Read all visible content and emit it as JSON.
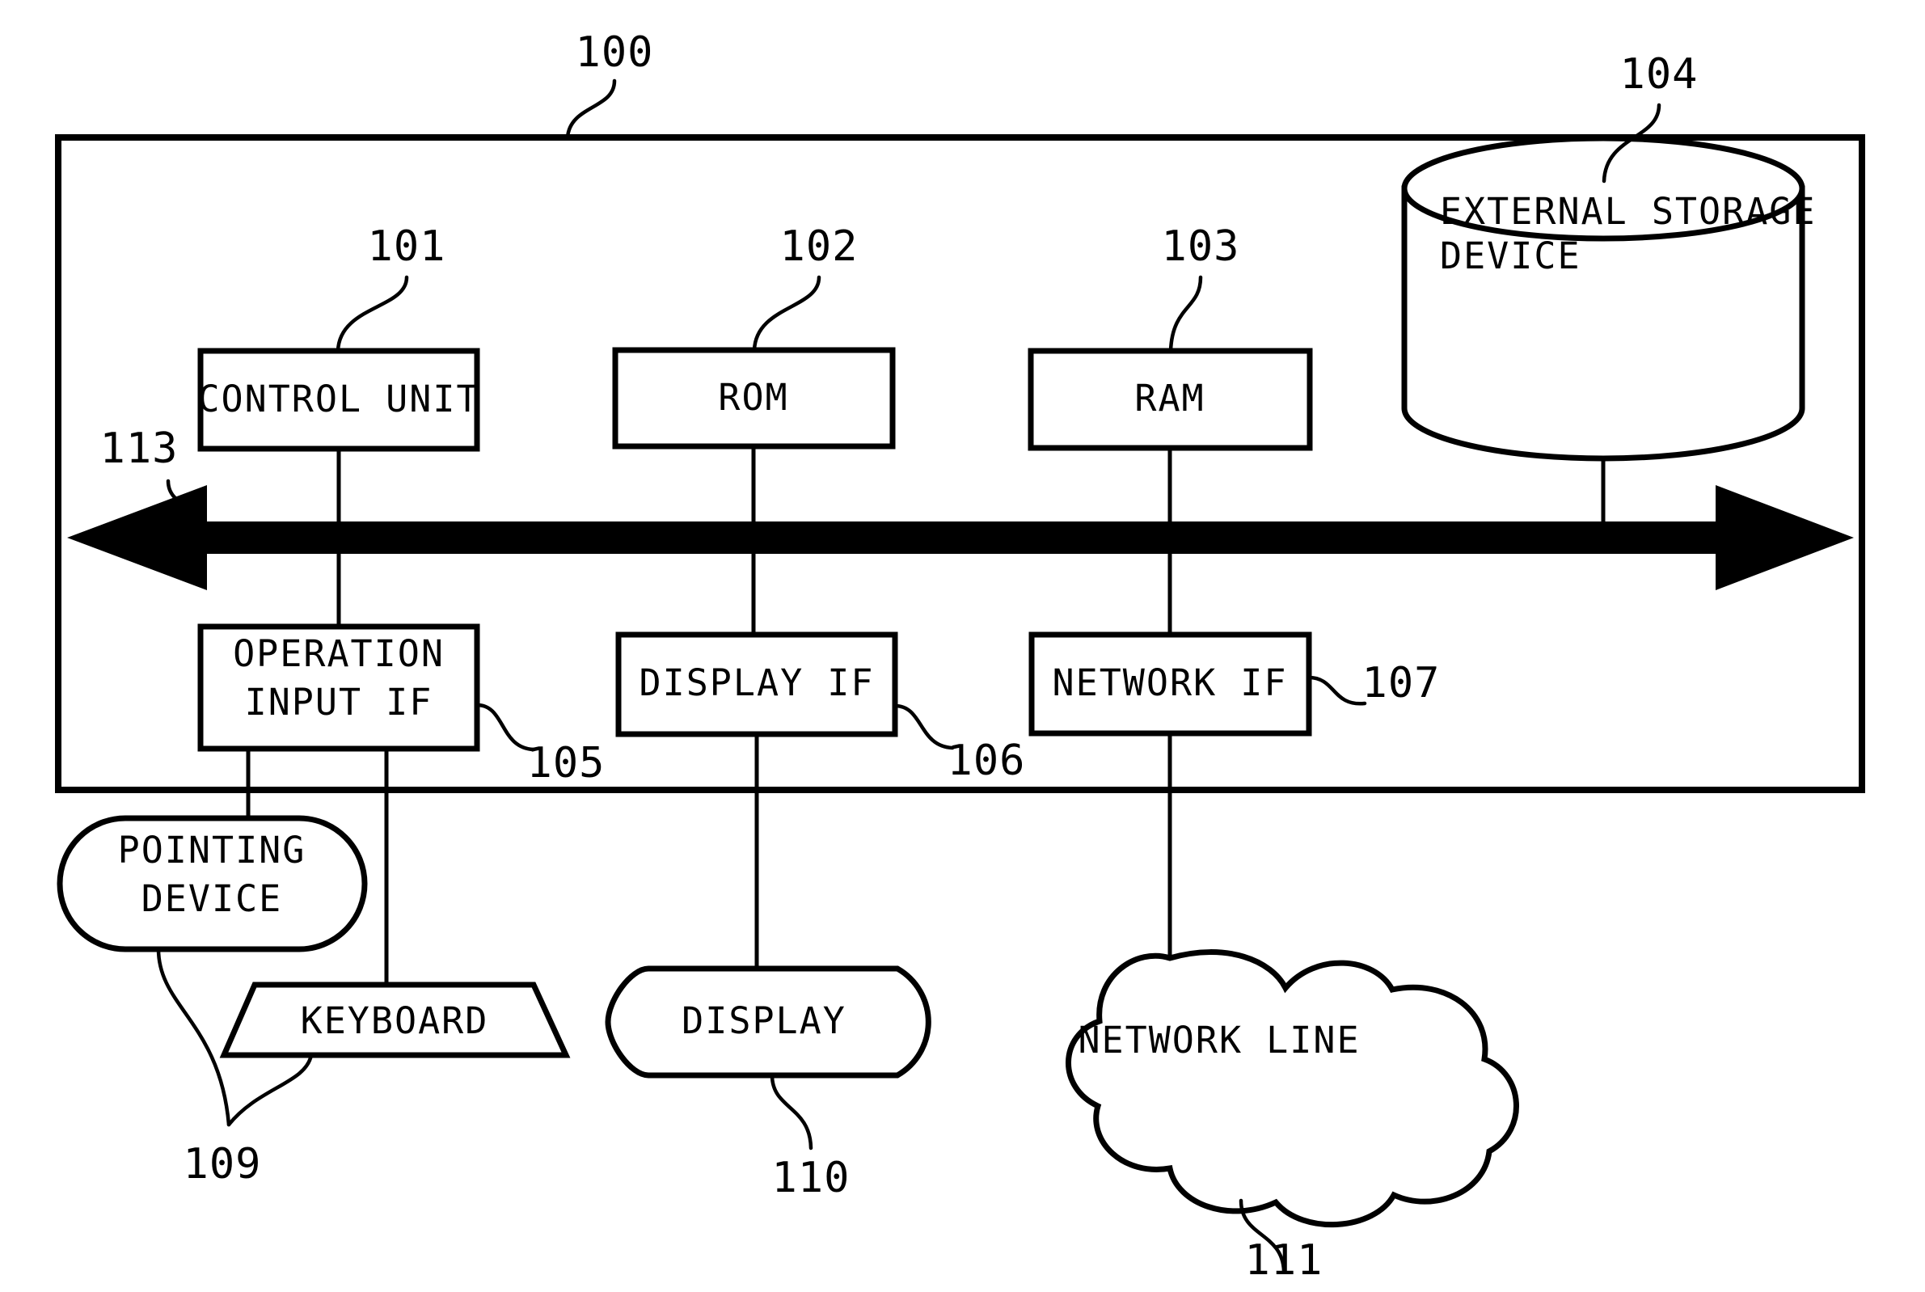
{
  "figure": {
    "type": "patent-block-diagram",
    "title": "Information processing apparatus hardware block diagram"
  },
  "refs": {
    "system": "100",
    "control_unit": "101",
    "rom": "102",
    "ram": "103",
    "external_storage": "104",
    "operation_input_if": "105",
    "display_if": "106",
    "network_if": "107",
    "input_devices": "109",
    "display": "110",
    "network_line": "111",
    "bus": "113"
  },
  "blocks": {
    "control_unit": "CONTROL UNIT",
    "rom": "ROM",
    "ram": "RAM",
    "external_storage_line1": "EXTERNAL STORAGE",
    "external_storage_line2": "DEVICE",
    "operation_input_if_line1": "OPERATION",
    "operation_input_if_line2": "INPUT IF",
    "display_if": "DISPLAY IF",
    "network_if": "NETWORK IF",
    "pointing_device_line1": "POINTING",
    "pointing_device_line2": "DEVICE",
    "keyboard": "KEYBOARD",
    "display": "DISPLAY",
    "network_line": "NETWORK LINE"
  },
  "colors": {
    "stroke": "#000000",
    "fill": "#ffffff",
    "bus": "#000000"
  }
}
